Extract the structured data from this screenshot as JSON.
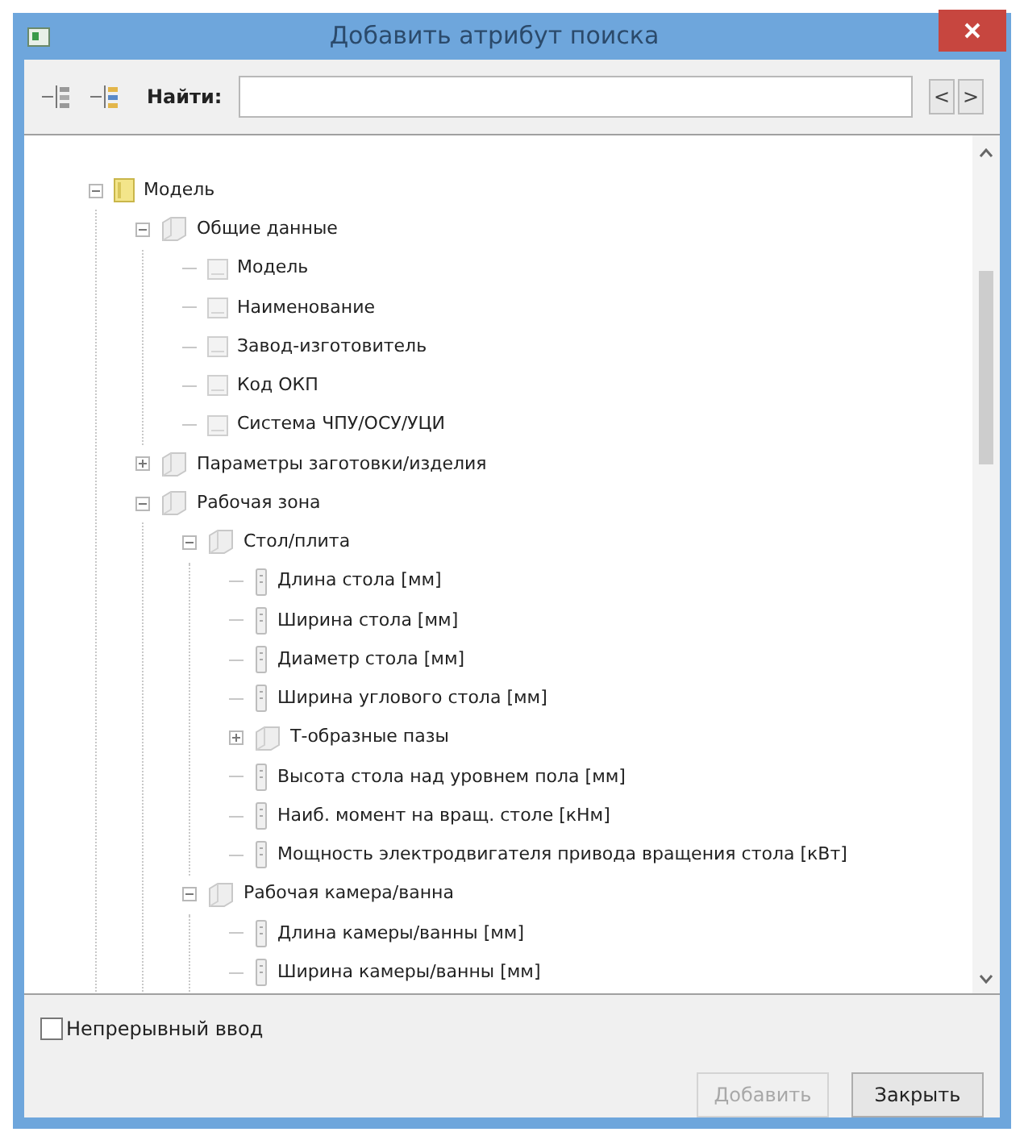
{
  "window": {
    "title": "Добавить атрибут поиска"
  },
  "toolbar": {
    "find_label": "Найти:",
    "prev": "<",
    "next": ">"
  },
  "tree": [
    {
      "label": "Модель",
      "kind": "model",
      "expanded": true,
      "children": [
        {
          "label": "Общие данные",
          "kind": "group",
          "expanded": true,
          "children": [
            {
              "label": "Модель",
              "kind": "item"
            },
            {
              "label": "Наименование",
              "kind": "item"
            },
            {
              "label": "Завод-изготовитель",
              "kind": "item"
            },
            {
              "label": "Код ОКП",
              "kind": "item"
            },
            {
              "label": "Система ЧПУ/ОСУ/УЦИ",
              "kind": "item"
            }
          ]
        },
        {
          "label": "Параметры заготовки/изделия",
          "kind": "group",
          "expanded": false
        },
        {
          "label": "Рабочая зона",
          "kind": "group",
          "expanded": true,
          "children": [
            {
              "label": "Стол/плита",
              "kind": "group",
              "expanded": true,
              "children": [
                {
                  "label": "Длина стола [мм]",
                  "kind": "parameter"
                },
                {
                  "label": "Ширина стола [мм]",
                  "kind": "parameter"
                },
                {
                  "label": "Диаметр стола [мм]",
                  "kind": "parameter"
                },
                {
                  "label": "Ширина углового стола [мм]",
                  "kind": "parameter"
                },
                {
                  "label": "Т-образные пазы",
                  "kind": "group",
                  "expanded": false
                },
                {
                  "label": "Высота стола над уровнем пола [мм]",
                  "kind": "parameter"
                },
                {
                  "label": "Наиб. момент на вращ. столе [кНм]",
                  "kind": "parameter"
                },
                {
                  "label": "Мощность электродвигателя привода вращения стола [кВт]",
                  "kind": "parameter"
                }
              ]
            },
            {
              "label": "Рабочая камера/ванна",
              "kind": "group",
              "expanded": true,
              "children": [
                {
                  "label": "Длина камеры/ванны [мм]",
                  "kind": "parameter"
                },
                {
                  "label": "Ширина камеры/ванны [мм]",
                  "kind": "parameter"
                }
              ]
            }
          ]
        }
      ]
    }
  ],
  "continuous_input": {
    "label": "Непрерывный ввод",
    "checked": false
  },
  "buttons": [
    {
      "label": "Добавить",
      "disabled": true
    },
    {
      "label": "Закрыть",
      "disabled": false
    }
  ]
}
